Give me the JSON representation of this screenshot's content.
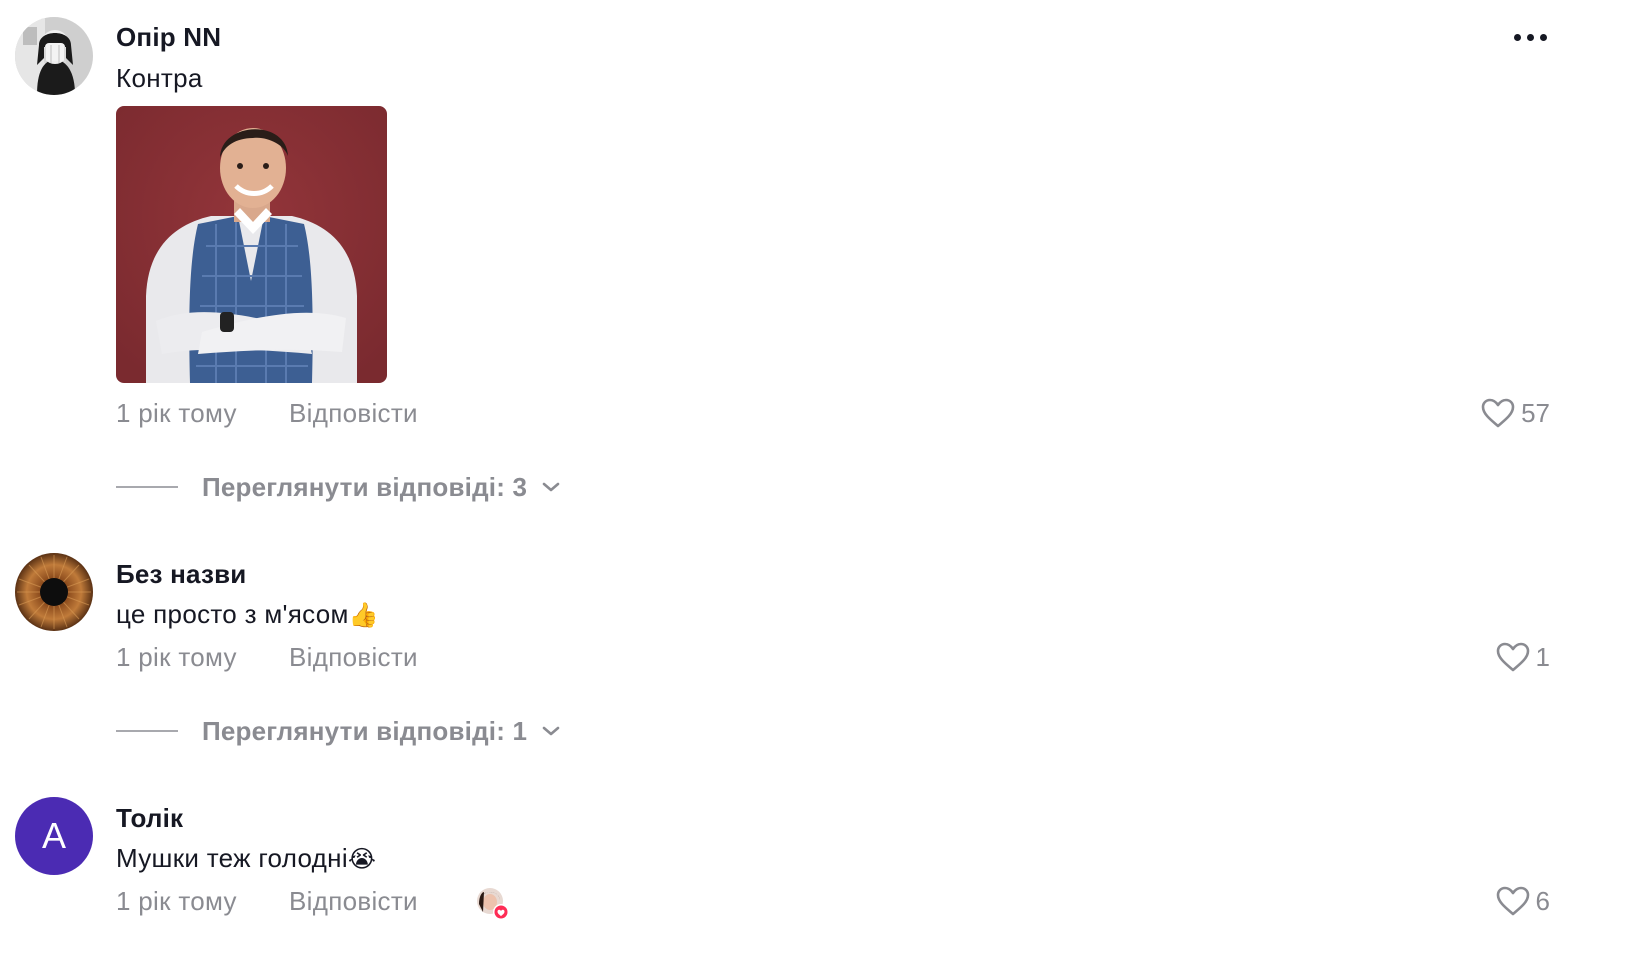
{
  "comments": [
    {
      "author": "Опір NN",
      "text": "Контра",
      "time": "1 рік тому",
      "reply_label": "Відповісти",
      "likes": "57",
      "avatar_icon": "user-photo-avatar",
      "attachment": "image",
      "replies_label": "Переглянути відповіді: 3"
    },
    {
      "author": "Без назви",
      "text": "це просто з м'ясом",
      "emoji": "👍",
      "time": "1 рік тому",
      "reply_label": "Відповісти",
      "likes": "1",
      "avatar_icon": "eye-iris-avatar",
      "replies_label": "Переглянути відповіді: 1"
    },
    {
      "author": "Толік",
      "avatar_letter": "А",
      "avatar_color": "#4b2bb3",
      "text": "Мушки теж голодні",
      "emoji": "😭",
      "time": "1 рік тому",
      "reply_label": "Відповісти",
      "likes": "6",
      "liked_by_creator": true
    }
  ],
  "colors": {
    "primary_text": "#161823",
    "secondary_text": "#8a8b91",
    "like_badge": "#fe2c55"
  }
}
